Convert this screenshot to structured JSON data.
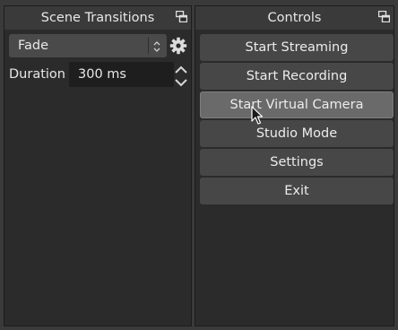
{
  "scene_transitions": {
    "title": "Scene Transitions",
    "transition_value": "Fade",
    "duration_label": "Duration",
    "duration_value": "300 ms"
  },
  "controls": {
    "title": "Controls",
    "buttons": [
      {
        "label": "Start Streaming"
      },
      {
        "label": "Start Recording"
      },
      {
        "label": "Start Virtual Camera"
      },
      {
        "label": "Studio Mode"
      },
      {
        "label": "Settings"
      },
      {
        "label": "Exit"
      }
    ]
  },
  "icons": {
    "float": "float-dock-icon",
    "gear": "gear-icon",
    "combo_arrows": "up-down-chevron-icon",
    "spin_up": "chevron-up-icon",
    "spin_down": "chevron-down-icon",
    "cursor": "mouse-pointer-icon"
  },
  "colors": {
    "panel_bg": "#2b2b2b",
    "window_bg": "#3a3a3a",
    "button_bg": "#474747",
    "button_hover_bg": "#6a6a6a",
    "input_bg": "#1e1e1e",
    "text": "#e8e8e8"
  }
}
